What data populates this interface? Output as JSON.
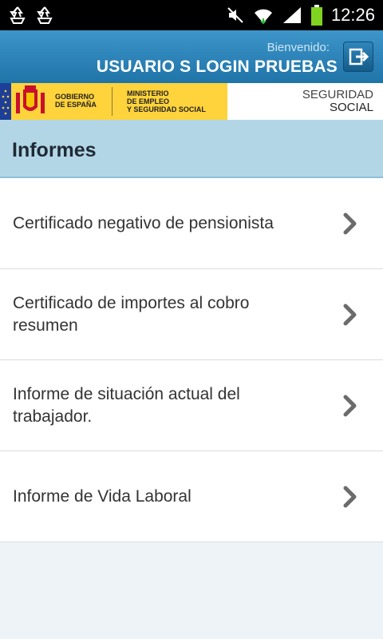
{
  "status_bar": {
    "time": "12:26",
    "icons": [
      "recycle-icon",
      "recycle-icon",
      "mute-icon",
      "wifi-icon",
      "signal-icon",
      "battery-icon"
    ]
  },
  "header": {
    "welcome": "Bienvenido:",
    "username": "USUARIO S LOGIN PRUEBAS",
    "logout_icon": "logout-icon"
  },
  "banner": {
    "gov_line1": "GOBIERNO",
    "gov_line2": "DE ESPAÑA",
    "min_line1": "MINISTERIO",
    "min_line2": "DE EMPLEO",
    "min_line3": "Y SEGURIDAD SOCIAL",
    "ss_line1": "SEGURIDAD",
    "ss_line2": "SOCIAL"
  },
  "section": {
    "title": "Informes"
  },
  "items": [
    {
      "label": "Certificado negativo de pensionista"
    },
    {
      "label": "Certificado de importes al cobro resumen"
    },
    {
      "label": "Informe de situación actual del trabajador."
    },
    {
      "label": "Informe de Vida Laboral"
    }
  ],
  "colors": {
    "header": "#1f74a8",
    "section_bg": "#b3d6e6",
    "gov_yellow": "#ffd33b",
    "page_bg": "#eef3f8"
  }
}
